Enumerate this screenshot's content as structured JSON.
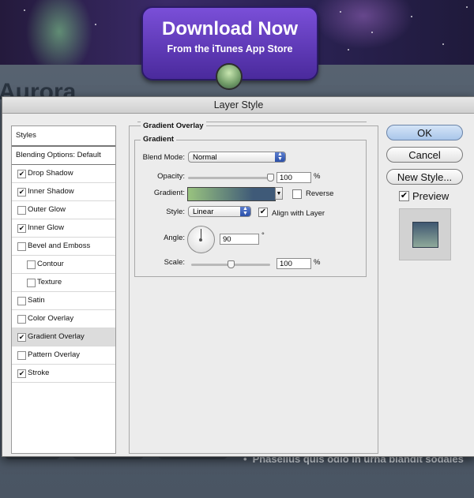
{
  "background": {
    "download_button": {
      "title": "Download Now",
      "subtitle": "From the iTunes App Store"
    },
    "heading_fragment": "Aurora",
    "bullet_text": "Phasellus quis odio in urna blandit sodales"
  },
  "dialog": {
    "title": "Layer Style",
    "styles_list": {
      "header": "Styles",
      "blending_options": "Blending Options: Default",
      "items": [
        {
          "label": "Drop Shadow",
          "checked": true,
          "indent": false,
          "selected": false
        },
        {
          "label": "Inner Shadow",
          "checked": true,
          "indent": false,
          "selected": false
        },
        {
          "label": "Outer Glow",
          "checked": false,
          "indent": false,
          "selected": false
        },
        {
          "label": "Inner Glow",
          "checked": true,
          "indent": false,
          "selected": false
        },
        {
          "label": "Bevel and Emboss",
          "checked": false,
          "indent": false,
          "selected": false
        },
        {
          "label": "Contour",
          "checked": false,
          "indent": true,
          "selected": false
        },
        {
          "label": "Texture",
          "checked": false,
          "indent": true,
          "selected": false
        },
        {
          "label": "Satin",
          "checked": false,
          "indent": false,
          "selected": false
        },
        {
          "label": "Color Overlay",
          "checked": false,
          "indent": false,
          "selected": false
        },
        {
          "label": "Gradient Overlay",
          "checked": true,
          "indent": false,
          "selected": true
        },
        {
          "label": "Pattern Overlay",
          "checked": false,
          "indent": false,
          "selected": false
        },
        {
          "label": "Stroke",
          "checked": true,
          "indent": false,
          "selected": false
        }
      ]
    },
    "panel": {
      "section_title": "Gradient Overlay",
      "group_title": "Gradient",
      "blend_mode_label": "Blend Mode:",
      "blend_mode_value": "Normal",
      "opacity_label": "Opacity:",
      "opacity_value": "100",
      "opacity_unit": "%",
      "opacity_level": 1.0,
      "gradient_label": "Gradient:",
      "gradient_colors": [
        "#99c37f",
        "#3f5a78"
      ],
      "reverse_label": "Reverse",
      "reverse_checked": false,
      "style_label": "Style:",
      "style_value": "Linear",
      "align_label": "Align with Layer",
      "align_checked": true,
      "angle_label": "Angle:",
      "angle_value": "90",
      "angle_unit": "°",
      "scale_label": "Scale:",
      "scale_value": "100",
      "scale_unit": "%",
      "scale_level": 0.5
    },
    "buttons": {
      "ok": "OK",
      "cancel": "Cancel",
      "new_style": "New Style..."
    },
    "preview": {
      "label": "Preview",
      "checked": true
    }
  }
}
